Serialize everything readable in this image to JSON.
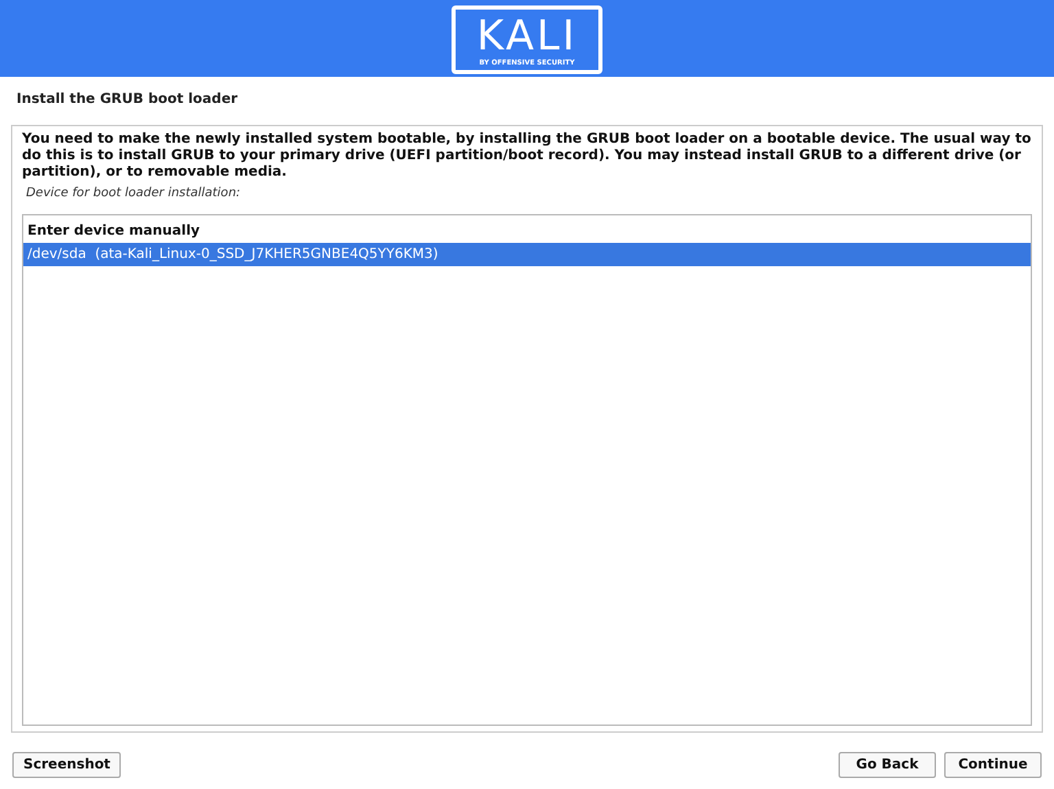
{
  "header": {
    "logo": "KALI",
    "tagline": "BY OFFENSIVE SECURITY"
  },
  "title": "Install the GRUB boot loader",
  "description": "You need to make the newly installed system bootable, by installing the GRUB boot loader on a bootable device. The usual way to do this is to install GRUB to your primary drive (UEFI partition/boot record). You may instead install GRUB to a different drive (or partition), or to removable media.",
  "prompt": "Device for boot loader installation:",
  "devices": [
    {
      "label": "Enter device manually",
      "selected": false
    },
    {
      "label": "/dev/sda  (ata-Kali_Linux-0_SSD_J7KHER5GNBE4Q5YY6KM3)",
      "selected": true
    }
  ],
  "buttons": {
    "left": [
      "Screenshot"
    ],
    "right": [
      "Go Back",
      "Continue"
    ]
  }
}
